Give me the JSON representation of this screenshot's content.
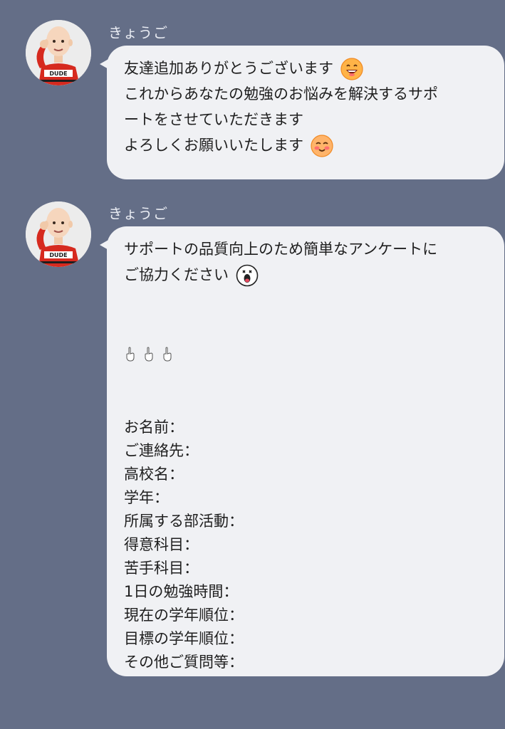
{
  "messages": [
    {
      "sender": "きょうご",
      "lines": [
        "友達追加ありがとうございます",
        "これからあなたの勉強のお悩みを解決するサポ",
        "ートをさせていただきます",
        "よろしくお願いいたします"
      ],
      "emojis": [
        "grinning-face-icon",
        "smiling-blush-face-icon"
      ]
    },
    {
      "sender": "きょうご",
      "intro_lines": [
        "サポートの品質向上のため簡単なアンケートに",
        "ご協力ください"
      ],
      "emoji": "surprised-face-sticker-icon",
      "pointing_icons": [
        "pointing-down-hand-icon",
        "pointing-down-hand-icon",
        "pointing-down-hand-icon"
      ],
      "form_lines": [
        "お名前：",
        "ご連絡先：",
        "高校名：",
        "学年：",
        "所属する部活動：",
        "得意科目：",
        "苦手科目：",
        "1日の勉強時間：",
        "現在の学年順位：",
        "目標の学年順位：",
        "その他ご質問等："
      ]
    }
  ],
  "colors": {
    "background": "#646e87",
    "bubble": "#f0f1f4",
    "text": "#1f1f1f",
    "sender": "#e8ebf2"
  }
}
